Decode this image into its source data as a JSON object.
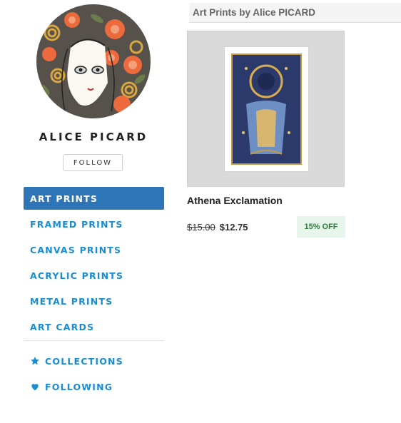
{
  "artist": {
    "name": "ALICE PICARD",
    "follow_label": "FOLLOW"
  },
  "nav": {
    "items": [
      {
        "label": "ART PRINTS",
        "active": true
      },
      {
        "label": "FRAMED PRINTS"
      },
      {
        "label": "CANVAS PRINTS"
      },
      {
        "label": "ACRYLIC PRINTS"
      },
      {
        "label": "METAL PRINTS"
      },
      {
        "label": "ART CARDS"
      }
    ]
  },
  "extra": {
    "collections": {
      "label": "COLLECTIONS",
      "icon": "star-icon"
    },
    "following": {
      "label": "FOLLOWING",
      "icon": "heart-icon"
    }
  },
  "main": {
    "section_title": "Art Prints by Alice PICARD",
    "product": {
      "title": "Athena Exclamation",
      "old_price": "$15.00",
      "price": "$12.75",
      "discount": "15% OFF"
    }
  },
  "colors": {
    "accent": "#1b8ccf",
    "active_bg": "#2e75b8",
    "discount_bg": "#e7f5ea",
    "discount_text": "#2e7d3a"
  }
}
